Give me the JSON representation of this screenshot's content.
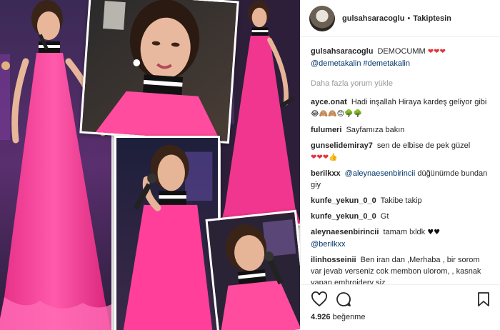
{
  "post": {
    "username": "gulsahsaracoglu",
    "separator": "•",
    "follow_status": "Takiptesin",
    "caption": {
      "user": "gulsahsaracoglu",
      "text": "DEMOCUMM",
      "hearts": "❤❤❤",
      "mention": "@demetakalin",
      "hashtag": "#demetakalin"
    },
    "load_more": "Daha fazla yorum yükle",
    "comments": [
      {
        "user": "ayce.onat",
        "text": "Hadi inşallah Hiraya kardeş geliyor gibi",
        "emoji": "😂🙈🙈😊🌳🌳"
      },
      {
        "user": "fulumeri",
        "text": "Sayfamıza bakın",
        "emoji": ""
      },
      {
        "user": "gunselidemiray7",
        "text": "sen de elbise de pek güzel",
        "emoji": "❤❤❤👍"
      },
      {
        "user": "berilkxx",
        "mention": "@aleynaesenbirincii",
        "text": "düğünümde bundan giy"
      },
      {
        "user": "kunfe_yekun_0_0",
        "text": "Takibe takip",
        "emoji": ""
      },
      {
        "user": "kunfe_yekun_0_0",
        "text": "Gt",
        "emoji": ""
      },
      {
        "user": "aleynaesenbirincii",
        "text": "tamam lxldk",
        "emoji": "♥♥",
        "mention": "@berilkxx"
      },
      {
        "user": "ilinhosseinii",
        "text": "Ben iran dan ,Merhaba , bir sorom var jevab verseniz cok membon ulorom, , kasnak yapan embroidery siz",
        "emoji": ""
      }
    ],
    "likes_count": "4.926",
    "likes_label": "beğenme"
  },
  "icons": {
    "like": "heart-outline-icon",
    "comment": "speech-bubble-icon",
    "save": "bookmark-icon"
  },
  "colors": {
    "dress_pink": "#ff3f9a",
    "mention_blue": "#003569",
    "muted_gray": "#999999"
  }
}
